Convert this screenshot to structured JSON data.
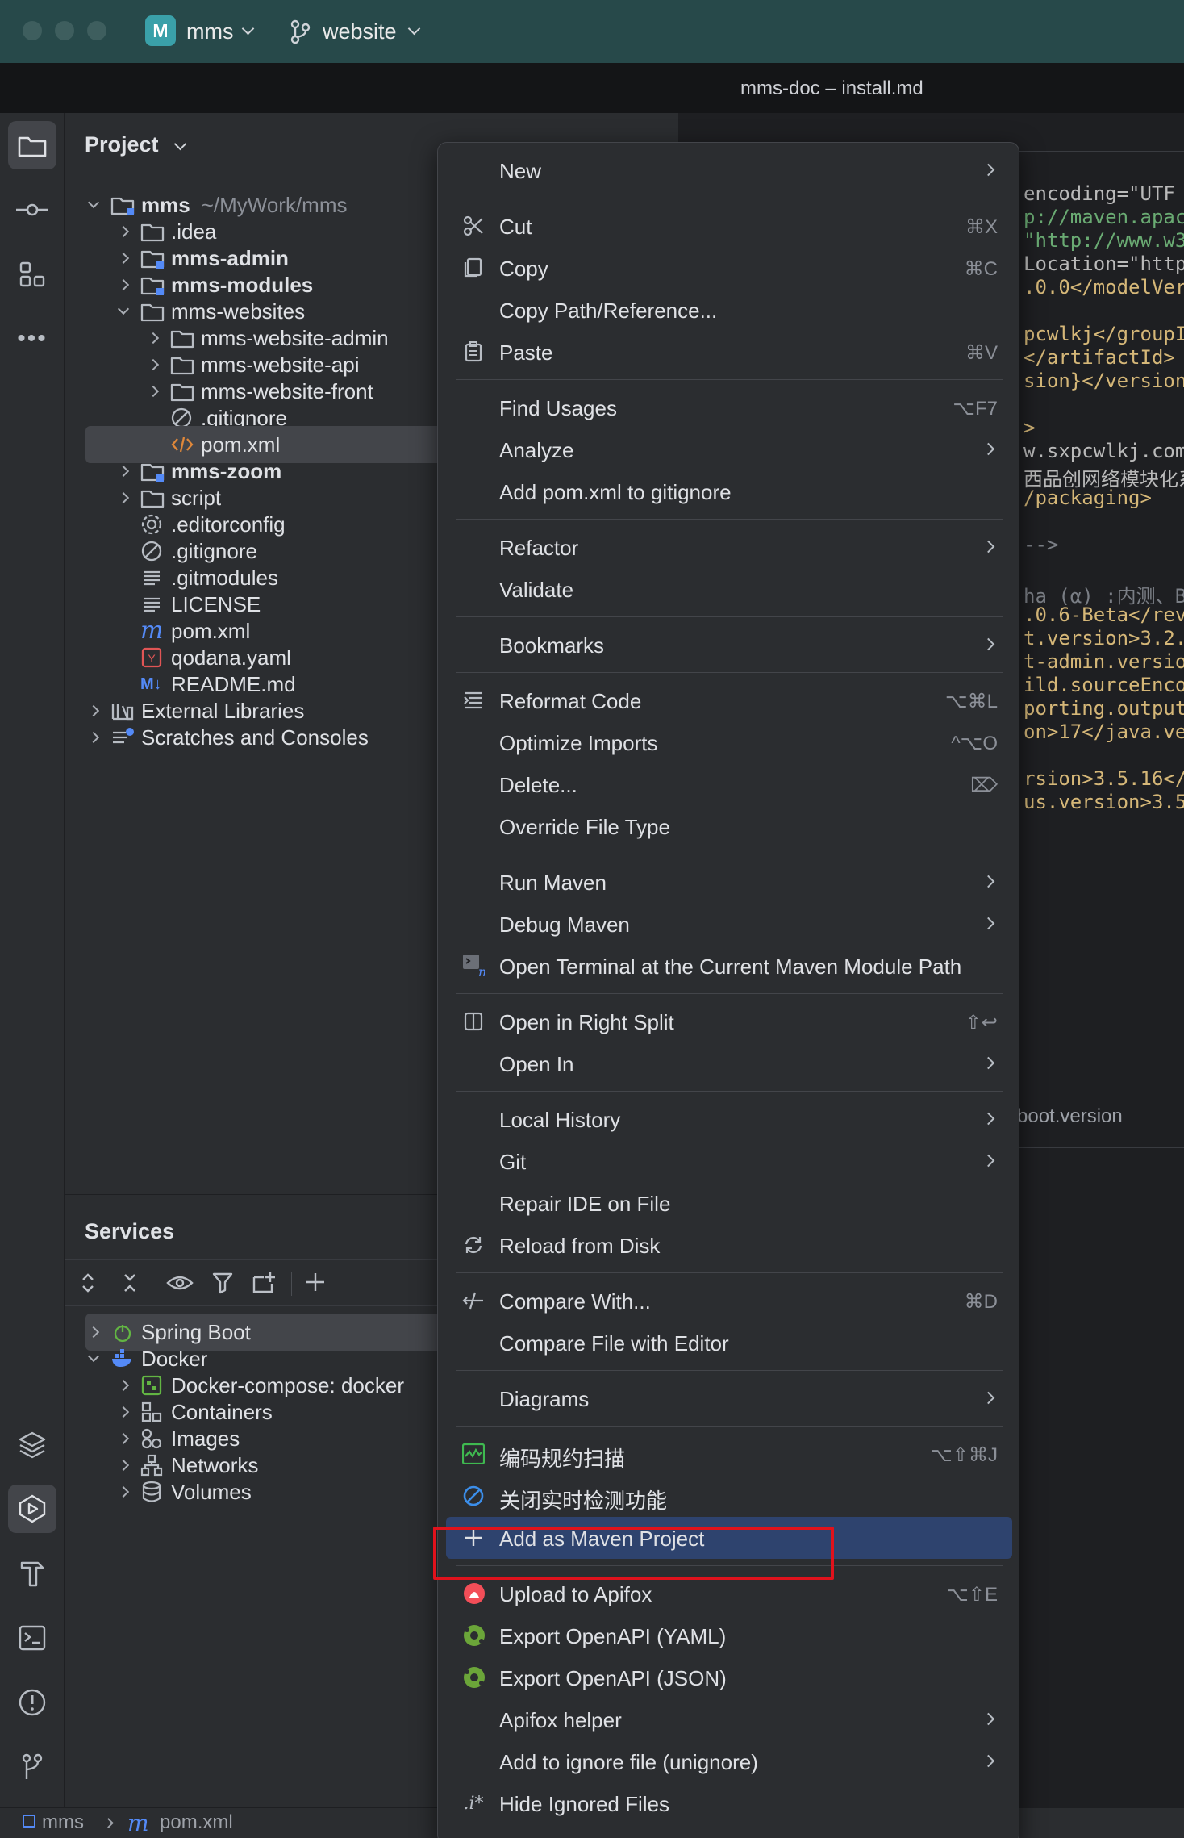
{
  "titlebar": {
    "project_badge": "M",
    "project_name": "mms",
    "branch_name": "website",
    "window_title": "mms-doc – install.md"
  },
  "project_panel": {
    "title": "Project",
    "tree": [
      {
        "label": "mms",
        "extra": "~/MyWork/mms",
        "depth": 0,
        "expanded": true,
        "bold": true,
        "kind": "module-folder"
      },
      {
        "label": ".idea",
        "depth": 1,
        "expanded": false,
        "kind": "folder"
      },
      {
        "label": "mms-admin",
        "depth": 1,
        "expanded": false,
        "bold": true,
        "kind": "module-folder"
      },
      {
        "label": "mms-modules",
        "depth": 1,
        "expanded": false,
        "bold": true,
        "kind": "module-folder"
      },
      {
        "label": "mms-websites",
        "depth": 1,
        "expanded": true,
        "kind": "folder"
      },
      {
        "label": "mms-website-admin",
        "depth": 2,
        "expanded": false,
        "kind": "folder"
      },
      {
        "label": "mms-website-api",
        "depth": 2,
        "expanded": false,
        "kind": "folder"
      },
      {
        "label": "mms-website-front",
        "depth": 2,
        "expanded": false,
        "kind": "folder"
      },
      {
        "label": ".gitignore",
        "depth": 2,
        "kind": "ignore"
      },
      {
        "label": "pom.xml",
        "depth": 2,
        "kind": "xml",
        "selected": true
      },
      {
        "label": "mms-zoom",
        "depth": 1,
        "expanded": false,
        "bold": true,
        "kind": "module-folder"
      },
      {
        "label": "script",
        "depth": 1,
        "expanded": false,
        "kind": "folder"
      },
      {
        "label": ".editorconfig",
        "depth": 1,
        "kind": "gear"
      },
      {
        "label": ".gitignore",
        "depth": 1,
        "kind": "ignore"
      },
      {
        "label": ".gitmodules",
        "depth": 1,
        "kind": "text"
      },
      {
        "label": "LICENSE",
        "depth": 1,
        "kind": "text"
      },
      {
        "label": "pom.xml",
        "depth": 1,
        "kind": "maven"
      },
      {
        "label": "qodana.yaml",
        "depth": 1,
        "kind": "yaml"
      },
      {
        "label": "README.md",
        "depth": 1,
        "kind": "markdown"
      },
      {
        "label": "External Libraries",
        "depth": 0,
        "expanded": false,
        "kind": "libraries"
      },
      {
        "label": "Scratches and Consoles",
        "depth": 0,
        "expanded": false,
        "kind": "scratches"
      }
    ]
  },
  "services_panel": {
    "title": "Services",
    "tree": [
      {
        "label": "Spring Boot",
        "depth": 0,
        "expanded": false,
        "kind": "spring",
        "selected": true
      },
      {
        "label": "Docker",
        "depth": 0,
        "expanded": true,
        "kind": "docker"
      },
      {
        "label": "Docker-compose: docker",
        "depth": 1,
        "expanded": false,
        "kind": "compose"
      },
      {
        "label": "Containers",
        "depth": 1,
        "expanded": false,
        "kind": "containers"
      },
      {
        "label": "Images",
        "depth": 1,
        "expanded": false,
        "kind": "images"
      },
      {
        "label": "Networks",
        "depth": 1,
        "expanded": false,
        "kind": "networks"
      },
      {
        "label": "Volumes",
        "depth": 1,
        "expanded": false,
        "kind": "volumes"
      }
    ]
  },
  "editor": {
    "lines": [
      {
        "t": "encoding=\"UTF",
        "c": "attr"
      },
      {
        "t": "p://maven.apac",
        "c": "str"
      },
      {
        "t": "\"http://www.w3",
        "c": "str"
      },
      {
        "t": "Location=\"http",
        "c": "attr"
      },
      {
        "t": ".0.0</modelVer",
        "c": "tag"
      },
      {
        "t": "",
        "c": ""
      },
      {
        "t": "pcwlkj</groupI",
        "c": "tag"
      },
      {
        "t": "</artifactId>",
        "c": "tag"
      },
      {
        "t": "sion}</version",
        "c": "tag"
      },
      {
        "t": "",
        "c": ""
      },
      {
        "t": ">",
        "c": "tag"
      },
      {
        "t": "w.sxpcwlkj.com",
        "c": "attr"
      },
      {
        "t": "西品创网络模块化系",
        "c": "attr"
      },
      {
        "t": "/packaging>",
        "c": "tag"
      },
      {
        "t": "",
        "c": ""
      },
      {
        "t": "-->",
        "c": "cmt"
      },
      {
        "t": "",
        "c": ""
      },
      {
        "t": "ha (α) :内测、Be",
        "c": "cmt"
      },
      {
        "t": ".0.6-Beta</rev",
        "c": "tag"
      },
      {
        "t": "t.version>3.2.",
        "c": "tag"
      },
      {
        "t": "t-admin.versio",
        "c": "tag"
      },
      {
        "t": "ild.sourceEnco",
        "c": "tag"
      },
      {
        "t": "porting.output",
        "c": "tag"
      },
      {
        "t": "on>17</java.ve",
        "c": "tag"
      },
      {
        "t": "",
        "c": ""
      },
      {
        "t": "rsion>3.5.16</",
        "c": "tag"
      },
      {
        "t": "us.version>3.5",
        "c": "tag"
      }
    ],
    "breadcrumb_fragment": "boot.version"
  },
  "context_menu": {
    "items": [
      {
        "type": "item",
        "label": "New",
        "submenu": true
      },
      {
        "type": "sep"
      },
      {
        "type": "item",
        "label": "Cut",
        "icon": "scissors-icon",
        "shortcut": "⌘X"
      },
      {
        "type": "item",
        "label": "Copy",
        "icon": "copy-icon",
        "shortcut": "⌘C"
      },
      {
        "type": "item",
        "label": "Copy Path/Reference..."
      },
      {
        "type": "item",
        "label": "Paste",
        "icon": "paste-icon",
        "shortcut": "⌘V"
      },
      {
        "type": "sep"
      },
      {
        "type": "item",
        "label": "Find Usages",
        "shortcut": "⌥F7"
      },
      {
        "type": "item",
        "label": "Analyze",
        "submenu": true
      },
      {
        "type": "item",
        "label": "Add pom.xml to gitignore"
      },
      {
        "type": "sep"
      },
      {
        "type": "item",
        "label": "Refactor",
        "submenu": true
      },
      {
        "type": "item",
        "label": "Validate"
      },
      {
        "type": "sep"
      },
      {
        "type": "item",
        "label": "Bookmarks",
        "submenu": true
      },
      {
        "type": "sep"
      },
      {
        "type": "item",
        "label": "Reformat Code",
        "icon": "reformat-icon",
        "shortcut": "⌥⌘L"
      },
      {
        "type": "item",
        "label": "Optimize Imports",
        "shortcut": "^⌥O"
      },
      {
        "type": "item",
        "label": "Delete...",
        "shortcut": "⌦"
      },
      {
        "type": "item",
        "label": "Override File Type"
      },
      {
        "type": "sep"
      },
      {
        "type": "item",
        "label": "Run Maven",
        "submenu": true
      },
      {
        "type": "item",
        "label": "Debug Maven",
        "submenu": true
      },
      {
        "type": "item",
        "label": "Open Terminal at the Current Maven Module Path",
        "icon": "maven-terminal-icon"
      },
      {
        "type": "sep"
      },
      {
        "type": "item",
        "label": "Open in Right Split",
        "icon": "split-icon",
        "shortcut": "⇧↩"
      },
      {
        "type": "item",
        "label": "Open In",
        "submenu": true
      },
      {
        "type": "sep"
      },
      {
        "type": "item",
        "label": "Local History",
        "submenu": true
      },
      {
        "type": "item",
        "label": "Git",
        "submenu": true
      },
      {
        "type": "item",
        "label": "Repair IDE on File"
      },
      {
        "type": "item",
        "label": "Reload from Disk",
        "icon": "reload-icon"
      },
      {
        "type": "sep"
      },
      {
        "type": "item",
        "label": "Compare With...",
        "icon": "compare-icon",
        "shortcut": "⌘D"
      },
      {
        "type": "item",
        "label": "Compare File with Editor"
      },
      {
        "type": "sep"
      },
      {
        "type": "item",
        "label": "Diagrams",
        "submenu": true
      },
      {
        "type": "sep"
      },
      {
        "type": "item",
        "label": "编码规约扫描",
        "icon": "scan-icon",
        "shortcut": "⌥⇧⌘J"
      },
      {
        "type": "item",
        "label": "关闭实时检测功能",
        "icon": "disable-icon"
      },
      {
        "type": "item",
        "label": "Add as Maven Project",
        "icon": "plus-icon",
        "highlighted": true
      },
      {
        "type": "sep"
      },
      {
        "type": "item",
        "label": "Upload to Apifox",
        "icon": "apifox-icon",
        "shortcut": "⌥⇧E"
      },
      {
        "type": "item",
        "label": "Export OpenAPI (YAML)",
        "icon": "openapi-icon"
      },
      {
        "type": "item",
        "label": "Export OpenAPI (JSON)",
        "icon": "openapi-icon"
      },
      {
        "type": "item",
        "label": "Apifox helper",
        "submenu": true
      },
      {
        "type": "item",
        "label": "Add to ignore file (unignore)",
        "submenu": true
      },
      {
        "type": "item",
        "label": "Hide Ignored Files",
        "icon": "ignored-icon"
      }
    ]
  },
  "statusbar": {
    "crumb_1": "mms",
    "crumb_2": "pom.xml"
  },
  "colors": {
    "titlebar": "#27494a",
    "panel": "#2b2d30",
    "highlight": "#2e436e",
    "annotation_red": "#e0121c",
    "accent_blue": "#548af7"
  }
}
